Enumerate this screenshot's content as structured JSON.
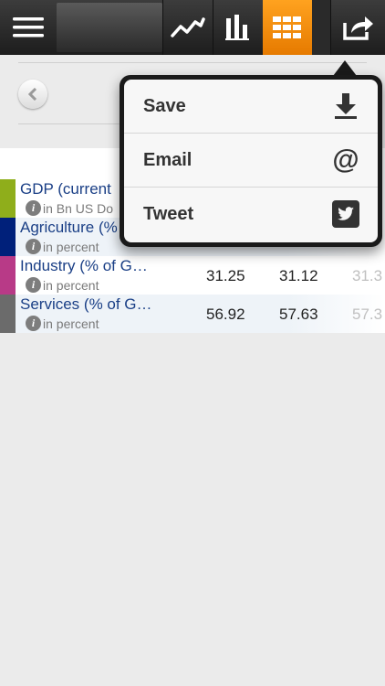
{
  "share_menu": {
    "items": [
      {
        "label": "Save",
        "icon": "download-icon"
      },
      {
        "label": "Email",
        "icon": "at-sign-icon"
      },
      {
        "label": "Tweet",
        "icon": "twitter-icon"
      }
    ]
  },
  "table": {
    "rows": [
      {
        "name": "GDP (current",
        "unit": "in Bn US Do",
        "color": "#8fae1b",
        "values": [
          "",
          "",
          ""
        ]
      },
      {
        "name": "Agriculture (%",
        "unit": "in percent",
        "color": "#00207a",
        "values": [
          "",
          "",
          ""
        ]
      },
      {
        "name": "Industry (% of G…",
        "unit": "in percent",
        "color": "#b83a87",
        "values": [
          "31.25",
          "31.12",
          "31.3"
        ]
      },
      {
        "name": "Services (% of G…",
        "unit": "in percent",
        "color": "#6b6b6b",
        "values": [
          "56.92",
          "57.63",
          "57.3"
        ]
      }
    ]
  },
  "colors": {
    "accent": "#f39000",
    "toolbar": "#222222"
  }
}
